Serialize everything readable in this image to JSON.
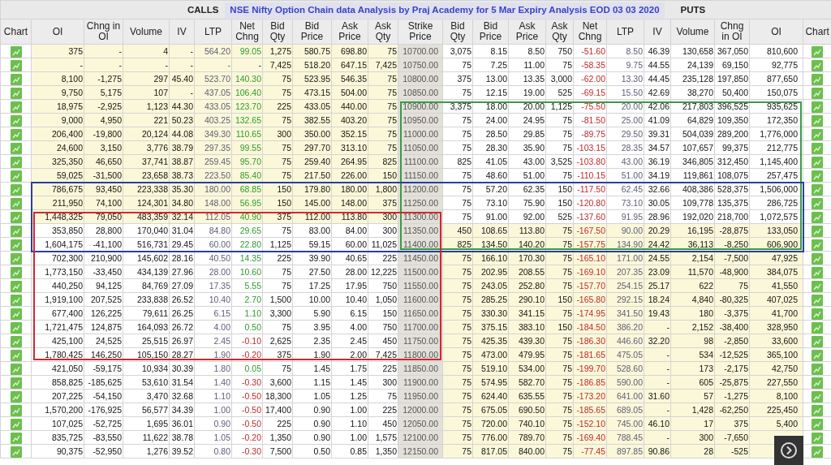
{
  "header": {
    "calls_label": "CALLS",
    "title": "NSE Nifty Option Chain data Analysis by Praj Academy for 5 Mar Expiry Analysis EOD 03 03 2020",
    "puts_label": "PUTS"
  },
  "columns": [
    "Chart",
    "OI",
    "Chng in OI",
    "Volume",
    "IV",
    "LTP",
    "Net Chng",
    "Bid Qty",
    "Bid Price",
    "Ask Price",
    "Ask Qty",
    "Strike Price",
    "Bid Qty",
    "Bid Price",
    "Ask Price",
    "Ask Qty",
    "Net Chng",
    "LTP",
    "IV",
    "Volume",
    "Chng in OI",
    "OI",
    "Chart"
  ],
  "highlights": [
    {
      "kind": "strike-puts",
      "color": "#3a9a4a"
    },
    {
      "kind": "full",
      "color": "#2b3f9e"
    },
    {
      "kind": "calls-strike",
      "color": "#d0282e"
    }
  ],
  "rows": [
    {
      "strike": "10700.00",
      "call_itm": true,
      "put_itm": false,
      "call_gain": true,
      "put_gain": false,
      "frames": [
        false,
        false,
        false
      ],
      "calls": [
        "375",
        "-",
        "4",
        "-",
        "564.20",
        "99.05",
        "1,275",
        "580.75",
        "698.80",
        "75"
      ],
      "puts": [
        "3,075",
        "8.15",
        "8.50",
        "750",
        "-51.60",
        "8.50",
        "46.39",
        "130,658",
        "367,050",
        "810,600"
      ]
    },
    {
      "strike": "10750.00",
      "call_itm": true,
      "put_itm": false,
      "put_gain": false,
      "frames": [
        false,
        false,
        false
      ],
      "calls": [
        "-",
        "-",
        "-",
        "-",
        "-",
        "-",
        "7,425",
        "518.20",
        "647.15",
        "7,425"
      ],
      "puts": [
        "75",
        "7.25",
        "11.00",
        "75",
        "-58.35",
        "9.75",
        "44.55",
        "24,139",
        "69,150",
        "92,775"
      ]
    },
    {
      "strike": "10800.00",
      "call_itm": true,
      "put_itm": false,
      "call_gain": true,
      "put_gain": false,
      "frames": [
        false,
        false,
        false
      ],
      "calls": [
        "8,100",
        "-1,275",
        "297",
        "45.40",
        "523.70",
        "140.30",
        "75",
        "523.95",
        "546.35",
        "75"
      ],
      "puts": [
        "375",
        "13.00",
        "13.35",
        "3,000",
        "-62.00",
        "13.30",
        "44.45",
        "235,128",
        "197,850",
        "877,650"
      ]
    },
    {
      "strike": "10850.00",
      "call_itm": true,
      "put_itm": false,
      "call_gain": true,
      "put_gain": false,
      "frames": [
        false,
        false,
        false
      ],
      "calls": [
        "9,750",
        "5,175",
        "107",
        "-",
        "437.05",
        "106.40",
        "75",
        "473.15",
        "504.00",
        "75"
      ],
      "puts": [
        "75",
        "12.15",
        "19.00",
        "525",
        "-69.15",
        "15.50",
        "42.69",
        "38,270",
        "50,400",
        "150,075"
      ]
    },
    {
      "strike": "10900.00",
      "call_itm": true,
      "put_itm": false,
      "call_gain": true,
      "put_gain": false,
      "frames": [
        true,
        false,
        false
      ],
      "calls": [
        "18,975",
        "-2,925",
        "1,123",
        "44.30",
        "433.05",
        "123.70",
        "225",
        "433.05",
        "440.00",
        "75"
      ],
      "puts": [
        "3,375",
        "18.00",
        "20.00",
        "1,125",
        "-75.50",
        "20.00",
        "42.06",
        "217,803",
        "396,525",
        "935,625"
      ]
    },
    {
      "strike": "10950.00",
      "call_itm": true,
      "put_itm": false,
      "call_gain": true,
      "put_gain": false,
      "frames": [
        true,
        false,
        false
      ],
      "calls": [
        "9,000",
        "4,950",
        "221",
        "50.23",
        "403.25",
        "132.65",
        "75",
        "382.55",
        "403.20",
        "75"
      ],
      "puts": [
        "75",
        "24.00",
        "24.95",
        "75",
        "-81.50",
        "25.00",
        "41.09",
        "64,829",
        "109,350",
        "172,350"
      ]
    },
    {
      "strike": "11000.00",
      "call_itm": true,
      "put_itm": false,
      "call_gain": true,
      "put_gain": false,
      "frames": [
        true,
        false,
        false
      ],
      "calls": [
        "206,400",
        "-19,800",
        "20,124",
        "44.08",
        "349.30",
        "110.65",
        "300",
        "350.00",
        "352.15",
        "75"
      ],
      "puts": [
        "75",
        "28.50",
        "29.85",
        "75",
        "-89.75",
        "29.50",
        "39.31",
        "504,039",
        "289,200",
        "1,776,000"
      ]
    },
    {
      "strike": "11050.00",
      "call_itm": true,
      "put_itm": false,
      "call_gain": true,
      "put_gain": false,
      "frames": [
        true,
        false,
        false
      ],
      "calls": [
        "24,600",
        "3,150",
        "3,776",
        "38.79",
        "297.35",
        "99.55",
        "75",
        "297.70",
        "313.10",
        "75"
      ],
      "puts": [
        "75",
        "28.30",
        "35.90",
        "75",
        "-103.15",
        "28.35",
        "34.57",
        "107,657",
        "99,375",
        "212,775"
      ]
    },
    {
      "strike": "11100.00",
      "call_itm": true,
      "put_itm": false,
      "call_gain": true,
      "put_gain": false,
      "frames": [
        true,
        false,
        false
      ],
      "calls": [
        "325,350",
        "46,650",
        "37,741",
        "38.87",
        "259.45",
        "95.70",
        "75",
        "259.40",
        "264.95",
        "825"
      ],
      "puts": [
        "825",
        "41.05",
        "43.00",
        "3,525",
        "-103.80",
        "43.00",
        "36.19",
        "346,805",
        "312,450",
        "1,145,400"
      ]
    },
    {
      "strike": "11150.00",
      "call_itm": true,
      "put_itm": false,
      "call_gain": true,
      "put_gain": false,
      "frames": [
        true,
        false,
        false
      ],
      "calls": [
        "59,025",
        "-31,500",
        "23,658",
        "38.73",
        "223.50",
        "85.40",
        "75",
        "217.50",
        "226.00",
        "150"
      ],
      "puts": [
        "75",
        "48.60",
        "51.00",
        "75",
        "-110.15",
        "51.00",
        "34.19",
        "119,861",
        "108,075",
        "257,475"
      ]
    },
    {
      "strike": "11200.00",
      "call_itm": true,
      "put_itm": false,
      "call_gain": true,
      "put_gain": false,
      "frames": [
        true,
        true,
        false
      ],
      "calls": [
        "786,675",
        "93,450",
        "223,338",
        "35.30",
        "180.00",
        "68.85",
        "150",
        "179.80",
        "180.00",
        "1,800"
      ],
      "puts": [
        "75",
        "57.20",
        "62.35",
        "150",
        "-117.50",
        "62.45",
        "32.66",
        "408,386",
        "528,375",
        "1,506,000"
      ]
    },
    {
      "strike": "11250.00",
      "call_itm": true,
      "put_itm": false,
      "call_gain": true,
      "put_gain": false,
      "frames": [
        true,
        true,
        false
      ],
      "calls": [
        "211,950",
        "74,100",
        "124,301",
        "34.80",
        "148.00",
        "56.95",
        "150",
        "145.00",
        "148.00",
        "375"
      ],
      "puts": [
        "75",
        "73.10",
        "75.90",
        "150",
        "-120.80",
        "73.10",
        "30.05",
        "109,778",
        "135,375",
        "286,725"
      ]
    },
    {
      "strike": "11300.00",
      "call_itm": true,
      "put_itm": false,
      "call_gain": true,
      "put_gain": false,
      "frames": [
        true,
        true,
        true
      ],
      "calls": [
        "1,448,325",
        "79,050",
        "483,359",
        "32.14",
        "112.05",
        "40.90",
        "375",
        "112.00",
        "113.80",
        "300"
      ],
      "puts": [
        "75",
        "91.00",
        "92.00",
        "525",
        "-137.60",
        "91.95",
        "28.96",
        "192,020",
        "218,700",
        "1,072,575"
      ]
    },
    {
      "strike": "11350.00",
      "call_itm": false,
      "put_itm": true,
      "call_gain": true,
      "put_gain": false,
      "frames": [
        true,
        true,
        true
      ],
      "calls": [
        "353,850",
        "28,800",
        "170,040",
        "31.04",
        "84.80",
        "29.65",
        "75",
        "83.00",
        "84.00",
        "300"
      ],
      "puts": [
        "450",
        "108.65",
        "113.80",
        "75",
        "-167.50",
        "90.00",
        "20.29",
        "16,195",
        "-28,875",
        "133,050"
      ]
    },
    {
      "strike": "11400.00",
      "call_itm": false,
      "put_itm": true,
      "call_gain": true,
      "put_gain": false,
      "frames": [
        true,
        true,
        true
      ],
      "calls": [
        "1,604,175",
        "-41,100",
        "516,731",
        "29.45",
        "60.00",
        "22.80",
        "1,125",
        "59.15",
        "60.00",
        "11,025"
      ],
      "puts": [
        "825",
        "134.50",
        "140.20",
        "75",
        "-157.75",
        "134.90",
        "24.42",
        "36,113",
        "-8,250",
        "606,900"
      ]
    },
    {
      "strike": "11450.00",
      "call_itm": false,
      "put_itm": true,
      "call_gain": true,
      "put_gain": false,
      "frames": [
        false,
        false,
        true
      ],
      "calls": [
        "702,300",
        "210,900",
        "145,602",
        "28.16",
        "40.50",
        "14.35",
        "225",
        "39.90",
        "40.65",
        "225"
      ],
      "puts": [
        "75",
        "166.10",
        "170.30",
        "75",
        "-165.10",
        "171.00",
        "24.55",
        "2,154",
        "-7,500",
        "47,925"
      ]
    },
    {
      "strike": "11500.00",
      "call_itm": false,
      "put_itm": true,
      "call_gain": true,
      "put_gain": false,
      "frames": [
        false,
        false,
        true
      ],
      "calls": [
        "1,773,150",
        "-33,450",
        "434,139",
        "27.96",
        "28.00",
        "10.60",
        "75",
        "27.50",
        "28.00",
        "12,225"
      ],
      "puts": [
        "75",
        "202.95",
        "208.55",
        "75",
        "-169.10",
        "207.35",
        "23.09",
        "11,570",
        "-48,900",
        "384,075"
      ]
    },
    {
      "strike": "11550.00",
      "call_itm": false,
      "put_itm": true,
      "call_gain": true,
      "put_gain": false,
      "frames": [
        false,
        false,
        true
      ],
      "calls": [
        "440,250",
        "94,125",
        "84,769",
        "27.09",
        "17.35",
        "5.55",
        "75",
        "17.25",
        "17.95",
        "750"
      ],
      "puts": [
        "75",
        "243.05",
        "252.80",
        "75",
        "-157.70",
        "254.15",
        "25.17",
        "622",
        "75",
        "41,550"
      ]
    },
    {
      "strike": "11600.00",
      "call_itm": false,
      "put_itm": true,
      "call_gain": true,
      "put_gain": false,
      "frames": [
        false,
        false,
        true
      ],
      "calls": [
        "1,919,100",
        "207,525",
        "233,838",
        "26.52",
        "10.40",
        "2.70",
        "1,500",
        "10.00",
        "10.40",
        "1,050"
      ],
      "puts": [
        "75",
        "285.25",
        "290.10",
        "150",
        "-165.80",
        "292.15",
        "18.24",
        "4,840",
        "-80,325",
        "407,025"
      ]
    },
    {
      "strike": "11650.00",
      "call_itm": false,
      "put_itm": true,
      "call_gain": true,
      "put_gain": false,
      "frames": [
        false,
        false,
        true
      ],
      "calls": [
        "677,400",
        "126,225",
        "79,611",
        "26.25",
        "6.15",
        "1.10",
        "3,300",
        "5.90",
        "6.15",
        "150"
      ],
      "puts": [
        "75",
        "330.30",
        "341.15",
        "75",
        "-174.95",
        "341.50",
        "19.43",
        "180",
        "-3,375",
        "41,700"
      ]
    },
    {
      "strike": "11700.00",
      "call_itm": false,
      "put_itm": true,
      "call_gain": true,
      "put_gain": false,
      "frames": [
        false,
        false,
        true
      ],
      "calls": [
        "1,721,475",
        "124,875",
        "164,093",
        "26.72",
        "4.00",
        "0.50",
        "75",
        "3.95",
        "4.00",
        "750"
      ],
      "puts": [
        "75",
        "375.15",
        "383.10",
        "150",
        "-184.50",
        "386.20",
        "-",
        "2,152",
        "-38,400",
        "328,950"
      ]
    },
    {
      "strike": "11750.00",
      "call_itm": false,
      "put_itm": true,
      "call_gain": false,
      "put_gain": false,
      "frames": [
        false,
        false,
        true
      ],
      "calls": [
        "425,100",
        "24,525",
        "25,515",
        "26.97",
        "2.45",
        "-0.10",
        "2,625",
        "2.35",
        "2.45",
        "450"
      ],
      "puts": [
        "75",
        "425.35",
        "439.30",
        "75",
        "-186.30",
        "446.60",
        "32.20",
        "98",
        "-2,850",
        "33,600"
      ]
    },
    {
      "strike": "11800.00",
      "call_itm": false,
      "put_itm": true,
      "call_gain": false,
      "put_gain": false,
      "frames": [
        false,
        false,
        true
      ],
      "calls": [
        "1,780,425",
        "146,250",
        "105,150",
        "28.27",
        "1.90",
        "-0.20",
        "375",
        "1.90",
        "2.00",
        "7,425"
      ],
      "puts": [
        "75",
        "473.00",
        "479.95",
        "75",
        "-181.65",
        "475.05",
        "-",
        "534",
        "-12,525",
        "365,100"
      ]
    },
    {
      "strike": "11850.00",
      "call_itm": false,
      "put_itm": true,
      "call_gain": true,
      "put_gain": false,
      "frames": [
        false,
        false,
        false
      ],
      "calls": [
        "421,050",
        "-59,175",
        "10,934",
        "30.39",
        "1.80",
        "0.05",
        "75",
        "1.45",
        "1.75",
        "225"
      ],
      "puts": [
        "75",
        "519.10",
        "534.00",
        "75",
        "-199.70",
        "528.60",
        "-",
        "173",
        "-2,175",
        "42,750"
      ]
    },
    {
      "strike": "11900.00",
      "call_itm": false,
      "put_itm": true,
      "call_gain": false,
      "put_gain": false,
      "frames": [
        false,
        false,
        false
      ],
      "calls": [
        "858,825",
        "-185,625",
        "53,610",
        "31.54",
        "1.40",
        "-0.30",
        "3,600",
        "1.15",
        "1.45",
        "300"
      ],
      "puts": [
        "75",
        "574.95",
        "582.70",
        "75",
        "-186.85",
        "590.00",
        "-",
        "605",
        "-25,875",
        "227,550"
      ]
    },
    {
      "strike": "11950.00",
      "call_itm": false,
      "put_itm": true,
      "call_gain": false,
      "put_gain": false,
      "frames": [
        false,
        false,
        false
      ],
      "calls": [
        "207,225",
        "-54,150",
        "3,470",
        "32.68",
        "1.10",
        "-0.50",
        "18,300",
        "1.05",
        "1.25",
        "75"
      ],
      "puts": [
        "75",
        "624.40",
        "635.55",
        "75",
        "-173.20",
        "641.00",
        "31.60",
        "57",
        "-1,275",
        "8,100"
      ]
    },
    {
      "strike": "12000.00",
      "call_itm": false,
      "put_itm": true,
      "call_gain": false,
      "put_gain": false,
      "frames": [
        false,
        false,
        false
      ],
      "calls": [
        "1,570,200",
        "-176,925",
        "56,577",
        "34.39",
        "1.00",
        "-0.50",
        "17,400",
        "0.90",
        "1.00",
        "225"
      ],
      "puts": [
        "75",
        "675.05",
        "690.50",
        "75",
        "-185.65",
        "689.05",
        "-",
        "1,428",
        "-62,250",
        "225,450"
      ]
    },
    {
      "strike": "12050.00",
      "call_itm": false,
      "put_itm": true,
      "call_gain": false,
      "put_gain": false,
      "frames": [
        false,
        false,
        false
      ],
      "calls": [
        "107,025",
        "-52,725",
        "1,695",
        "36.01",
        "0.90",
        "-0.50",
        "225",
        "0.90",
        "1.10",
        "450"
      ],
      "puts": [
        "75",
        "720.00",
        "740.10",
        "75",
        "-152.10",
        "745.00",
        "46.10",
        "17",
        "375",
        "5,400"
      ]
    },
    {
      "strike": "12100.00",
      "call_itm": false,
      "put_itm": true,
      "call_gain": false,
      "put_gain": false,
      "frames": [
        false,
        false,
        false
      ],
      "calls": [
        "835,725",
        "-83,550",
        "11,622",
        "38.78",
        "1.05",
        "-0.20",
        "1,350",
        "0.90",
        "1.00",
        "1,575"
      ],
      "puts": [
        "75",
        "776.00",
        "789.70",
        "75",
        "-169.40",
        "788.45",
        "-",
        "300",
        "-7,650"
      ]
    },
    {
      "strike": "12150.00",
      "call_itm": false,
      "put_itm": true,
      "call_gain": false,
      "put_gain": false,
      "frames": [
        false,
        false,
        false
      ],
      "calls": [
        "90,375",
        "-52,950",
        "1,276",
        "39.52",
        "0.80",
        "-0.30",
        "7,500",
        "0.50",
        "0.85",
        "1,350"
      ],
      "puts": [
        "75",
        "817.05",
        "840.00",
        "75",
        "-77.45",
        "897.85",
        "90.86",
        "28",
        "-525"
      ]
    }
  ]
}
